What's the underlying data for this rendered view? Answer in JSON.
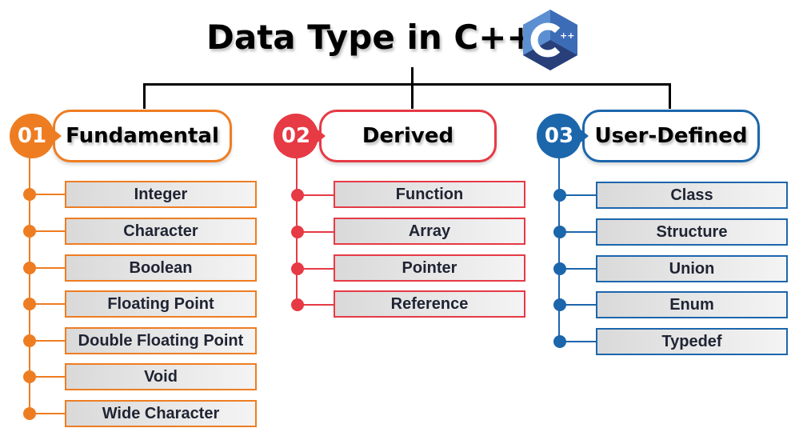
{
  "title": "Data Type in C++",
  "logo": {
    "icon": "cpp-logo-icon",
    "text": "C",
    "superscript": "++",
    "colors": {
      "dark": "#283f7a",
      "mid": "#3d6cb7",
      "light": "#5b8fd1"
    }
  },
  "categories": [
    {
      "number": "01",
      "label": "Fundamental",
      "color": "#ee7d22",
      "items": [
        "Integer",
        "Character",
        "Boolean",
        "Floating Point",
        "Double Floating Point",
        "Void",
        "Wide Character"
      ]
    },
    {
      "number": "02",
      "label": "Derived",
      "color": "#e63a45",
      "items": [
        "Function",
        "Array",
        "Pointer",
        "Reference"
      ]
    },
    {
      "number": "03",
      "label": "User-Defined",
      "color": "#1c66ac",
      "items": [
        "Class",
        "Structure",
        "Union",
        "Enum",
        "Typedef"
      ]
    }
  ]
}
